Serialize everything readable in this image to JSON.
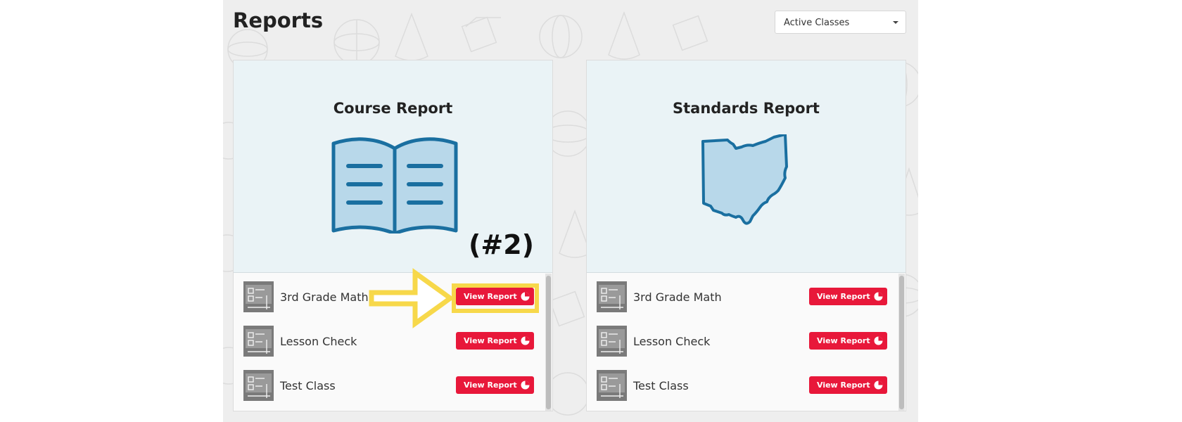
{
  "page": {
    "title": "Reports"
  },
  "class_filter": {
    "selected": "Active Classes"
  },
  "cards": [
    {
      "title": "Course Report",
      "icon": "open-book-icon",
      "classes": [
        {
          "name": "3rd Grade Math",
          "button": "View Report"
        },
        {
          "name": "Lesson Check",
          "button": "View Report"
        },
        {
          "name": "Test Class",
          "button": "View Report"
        }
      ]
    },
    {
      "title": "Standards Report",
      "icon": "ohio-state-map-icon",
      "classes": [
        {
          "name": "3rd Grade Math",
          "button": "View Report"
        },
        {
          "name": "Lesson Check",
          "button": "View Report"
        },
        {
          "name": "Test Class",
          "button": "View Report"
        }
      ]
    }
  ],
  "annotation": {
    "label": "(#2)",
    "highlight_color": "#f7d84a"
  },
  "colors": {
    "accent_red": "#e8183a",
    "icon_blue": "#1a6fa0",
    "icon_fill": "#b8d8ea",
    "hero_bg": "#eaf3f6"
  }
}
